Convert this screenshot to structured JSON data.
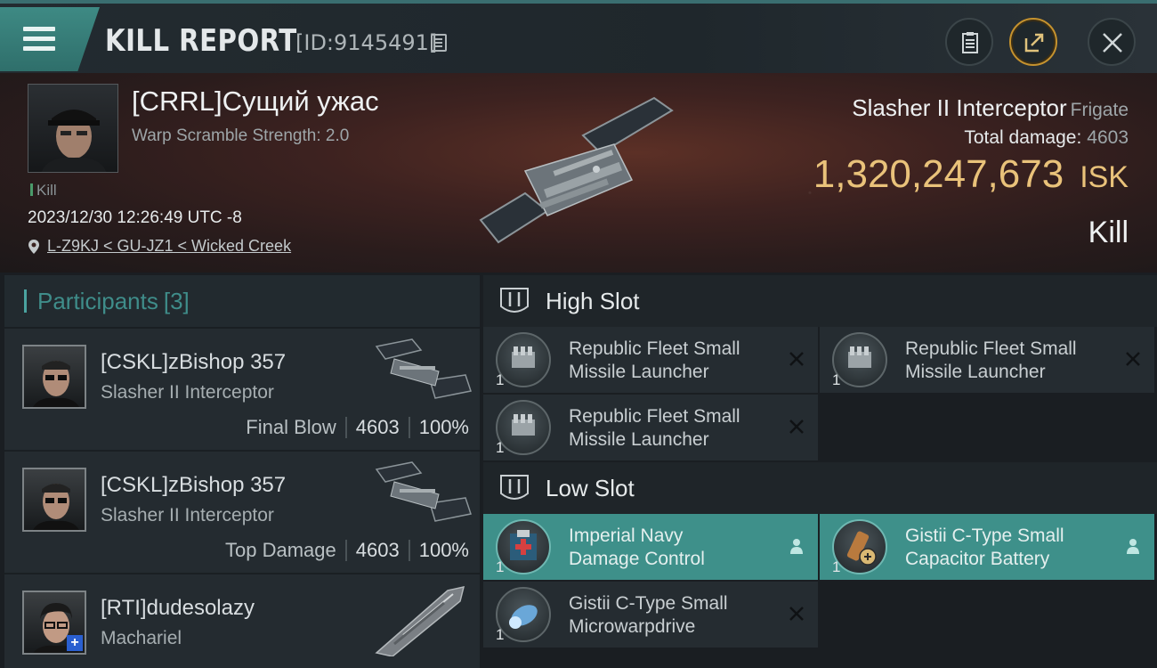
{
  "header": {
    "title": "KILL REPORT",
    "kill_id": "[ID:9145491]"
  },
  "victim": {
    "name": "[CRRL]Сущий ужас",
    "warp_scramble": "Warp Scramble Strength: 2.0",
    "kill_tag": "Kill",
    "time": "2023/12/30 12:26:49 UTC -8",
    "location": "L-Z9KJ < GU-JZ1 < Wicked Creek",
    "ship_name": "Slasher II Interceptor",
    "ship_class": "Frigate",
    "total_damage_label": "Total damage:",
    "total_damage": "4603",
    "isk_value": "1,320,247,673",
    "isk_unit": "ISK",
    "result": "Kill"
  },
  "participants": {
    "label": "Participants",
    "count": "[3]",
    "items": [
      {
        "name": "[CSKL]zBishop 357",
        "ship": "Slasher II Interceptor",
        "role": "Final Blow",
        "damage": "4603",
        "percent": "100%"
      },
      {
        "name": "[CSKL]zBishop 357",
        "ship": "Slasher II Interceptor",
        "role": "Top Damage",
        "damage": "4603",
        "percent": "100%"
      },
      {
        "name": "[RTI]dudesolazy",
        "ship": "Machariel",
        "role": "",
        "damage": "",
        "percent": ""
      }
    ]
  },
  "fitting": {
    "high_slot": {
      "label": "High Slot",
      "modules": [
        {
          "line1": "Republic Fleet Small",
          "line2": "Missile Launcher",
          "qty": "1",
          "state": "destroyed"
        },
        {
          "line1": "Republic Fleet Small",
          "line2": "Missile Launcher",
          "qty": "1",
          "state": "destroyed"
        },
        {
          "line1": "Republic Fleet Small",
          "line2": "Missile Launcher",
          "qty": "1",
          "state": "destroyed"
        }
      ]
    },
    "low_slot": {
      "label": "Low Slot",
      "modules": [
        {
          "line1": "Imperial Navy",
          "line2": "Damage Control",
          "qty": "1",
          "state": "dropped"
        },
        {
          "line1": "Gistii C-Type Small",
          "line2": "Capacitor Battery",
          "qty": "1",
          "state": "dropped"
        },
        {
          "line1": "Gistii C-Type Small",
          "line2": "Microwarpdrive",
          "qty": "1",
          "state": "destroyed"
        }
      ]
    }
  },
  "colors": {
    "accent_teal": "#3e908a",
    "isk_gold": "#e9c27a"
  }
}
